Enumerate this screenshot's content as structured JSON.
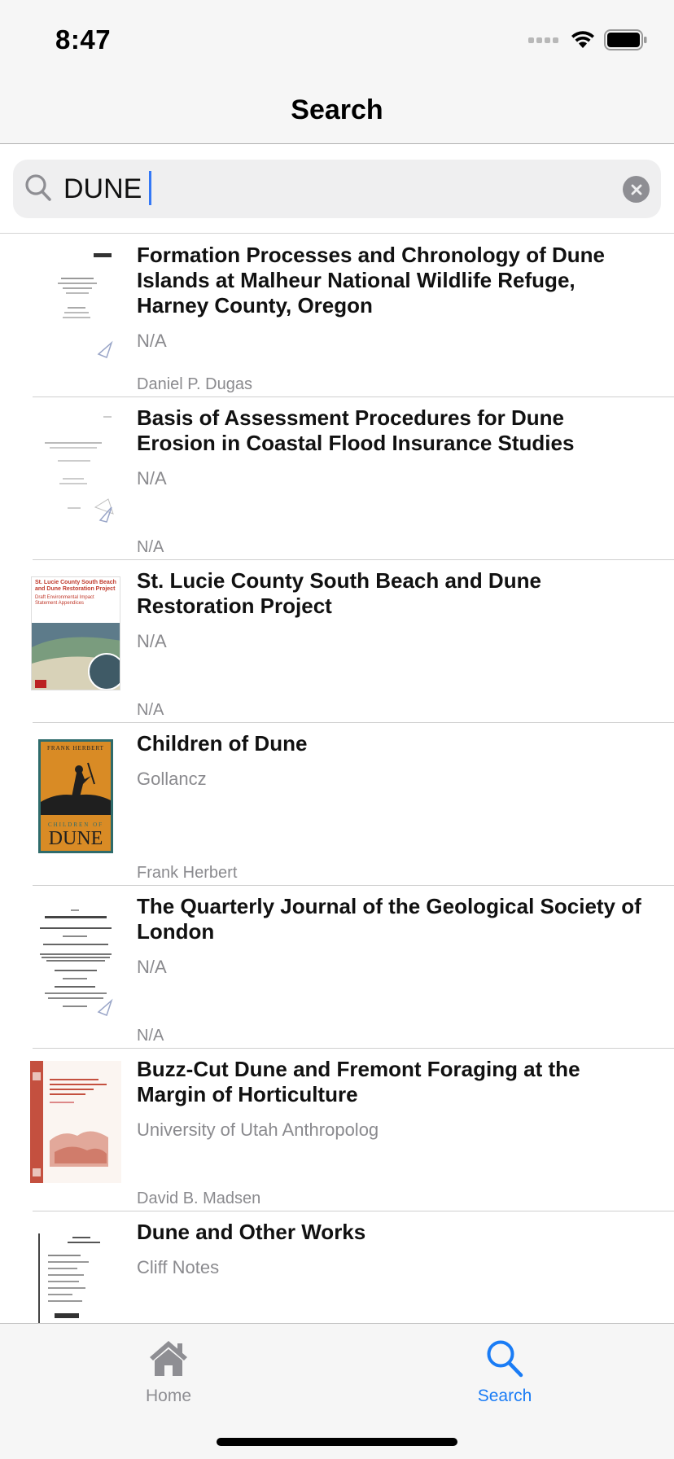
{
  "status_bar": {
    "time": "8:47"
  },
  "nav": {
    "title": "Search"
  },
  "search": {
    "value": "DUNE",
    "placeholder": ""
  },
  "results": [
    {
      "title": "Formation Processes and Chronology of Dune Islands at Malheur National Wildlife Refuge, Harney County, Oregon",
      "publisher": "N/A",
      "author": "Daniel P. Dugas"
    },
    {
      "title": "Basis of Assessment Procedures for Dune Erosion in Coastal Flood Insurance Studies",
      "publisher": "N/A",
      "author": "N/A"
    },
    {
      "title": "St. Lucie County South Beach and Dune Restoration Project",
      "publisher": "N/A",
      "author": "N/A"
    },
    {
      "title": "Children of Dune",
      "publisher": "Gollancz",
      "author": "Frank Herbert"
    },
    {
      "title": "The Quarterly Journal of the Geological Society of London",
      "publisher": "N/A",
      "author": "N/A"
    },
    {
      "title": "Buzz-Cut Dune and Fremont Foraging at the Margin of Horticulture",
      "publisher": "University of Utah Anthropolog",
      "author": "David B. Madsen"
    },
    {
      "title": "Dune and Other Works",
      "publisher": "Cliff Notes",
      "author": ""
    }
  ],
  "cover_text": {
    "st_lucie": "St. Lucie County South Beach and Dune Restoration Project",
    "st_lucie_sub": "Draft Environmental Impact Statement Appendices",
    "children_top": "FRANK HERBERT",
    "children_mid": "CHILDREN OF",
    "children_big": "DUNE"
  },
  "tabs": {
    "home_label": "Home",
    "search_label": "Search"
  },
  "colors": {
    "accent": "#1a7cf5",
    "inactive": "#8e8e93",
    "caret": "#3478f6"
  }
}
